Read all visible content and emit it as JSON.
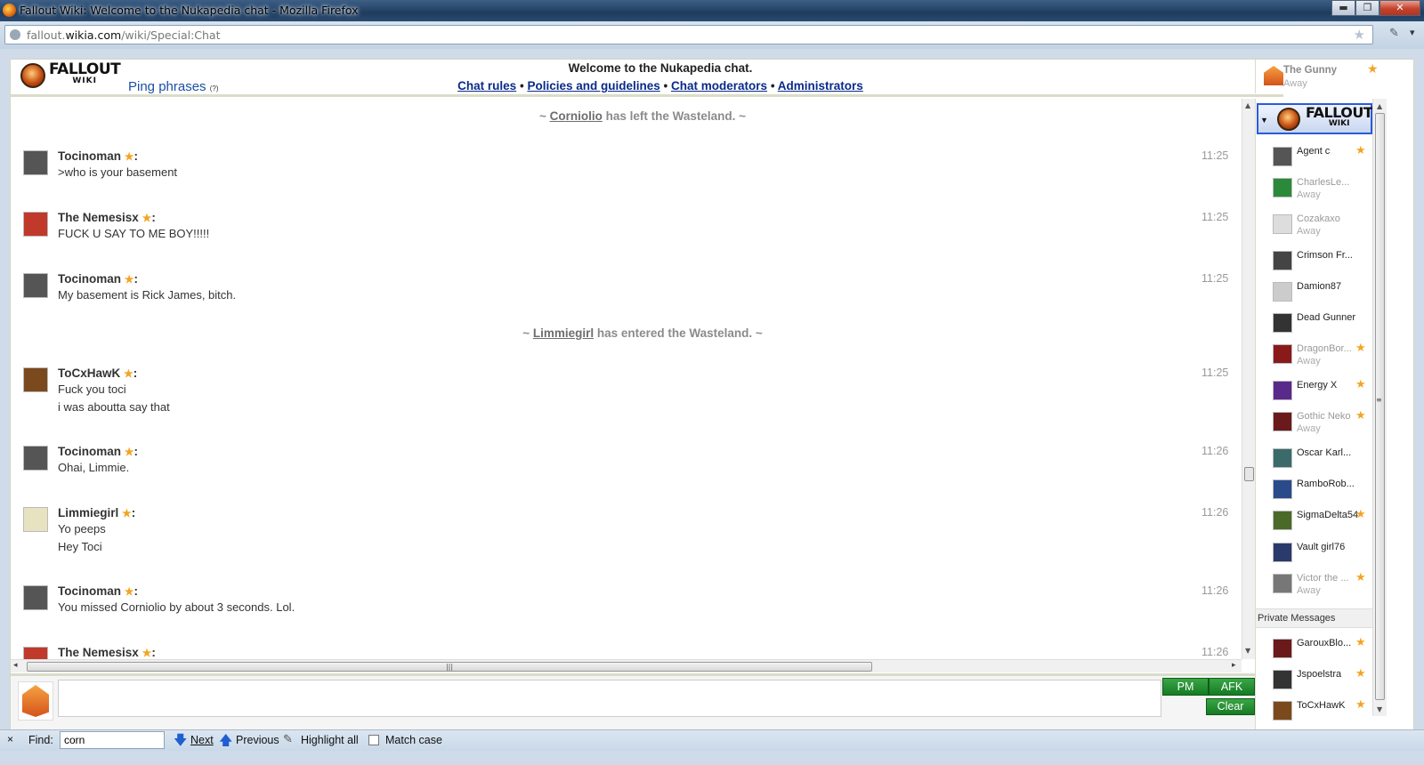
{
  "window": {
    "title": "Fallout Wiki: Welcome to the Nukapedia chat - Mozilla Firefox",
    "min_label": "▬",
    "max_label": "❐",
    "close_label": "✕"
  },
  "address": {
    "url_prefix": "fallout.",
    "url_domain": "wikia.com",
    "url_path": "/wiki/Special:Chat"
  },
  "header": {
    "logo_word1": "FALLOUT",
    "logo_word2": "WIKI",
    "ping_label": "Ping phrases",
    "ping_help": "(?)",
    "welcome": "Welcome to the Nukapedia chat.",
    "links": [
      "Chat rules",
      "Policies and guidelines",
      "Chat moderators",
      "Administrators"
    ],
    "separator": "•"
  },
  "self_user": {
    "name": "The Gunny",
    "status": "Away"
  },
  "chat": {
    "alerts": [
      {
        "prefix": "~ ",
        "user": "Corniolio",
        "text": " has left the Wasteland. ~"
      },
      {
        "prefix": "~ ",
        "user": "Limmiegirl",
        "text": " has entered the Wasteland. ~"
      }
    ],
    "messages": [
      {
        "user": "Tocinoman",
        "time": "11:25",
        "lines": [
          ">who is your basement"
        ]
      },
      {
        "user": "The Nemesisx",
        "time": "11:25",
        "lines": [
          "FUCK U SAY TO ME BOY!!!!!"
        ]
      },
      {
        "user": "Tocinoman",
        "time": "11:25",
        "lines": [
          "My basement is Rick James, bitch."
        ]
      },
      {
        "user": "ToCxHawK",
        "time": "11:25",
        "lines": [
          "Fuck you toci",
          "i was aboutta say that"
        ]
      },
      {
        "user": "Tocinoman",
        "time": "11:26",
        "lines": [
          "Ohai, Limmie."
        ]
      },
      {
        "user": "Limmiegirl",
        "time": "11:26",
        "lines": [
          "Yo peeps",
          "Hey Toci"
        ]
      },
      {
        "user": "Tocinoman",
        "time": "11:26",
        "lines": [
          "You missed Corniolio by about 3 seconds. Lol."
        ]
      },
      {
        "user": "The Nemesisx",
        "time": "11:26",
        "lines": []
      }
    ],
    "name_suffix": ":",
    "star": "★"
  },
  "input": {
    "value": "",
    "pm_label": "PM",
    "afk_label": "AFK",
    "clear_label": "Clear"
  },
  "userlist": {
    "users": [
      {
        "name": "Agent c",
        "status": "",
        "star": true
      },
      {
        "name": "CharlesLe...",
        "status": "Away",
        "star": false
      },
      {
        "name": "Cozakaxo",
        "status": "Away",
        "star": false
      },
      {
        "name": "Crimson Fr...",
        "status": "",
        "star": false
      },
      {
        "name": "Damion87",
        "status": "",
        "star": false
      },
      {
        "name": "Dead Gunner",
        "status": "",
        "star": false
      },
      {
        "name": "DragonBor...",
        "status": "Away",
        "star": true
      },
      {
        "name": "Energy X",
        "status": "",
        "star": true
      },
      {
        "name": "Gothic Neko",
        "status": "Away",
        "star": true
      },
      {
        "name": "Oscar Karl...",
        "status": "",
        "star": false
      },
      {
        "name": "RamboRob...",
        "status": "",
        "star": false
      },
      {
        "name": "SigmaDelta54",
        "status": "",
        "star": true
      },
      {
        "name": "Vault girl76",
        "status": "",
        "star": false
      },
      {
        "name": "Victor the ...",
        "status": "Away",
        "star": true
      }
    ],
    "pm_header": "Private Messages",
    "private": [
      {
        "name": "GarouxBlo...",
        "star": true
      },
      {
        "name": "Jspoelstra",
        "star": true
      },
      {
        "name": "ToCxHawK",
        "star": true
      }
    ]
  },
  "findbar": {
    "close": "×",
    "label": "Find:",
    "value": "corn",
    "next": "Next",
    "previous": "Previous",
    "highlight": "Highlight all",
    "match_case": "Match case"
  },
  "colors": {
    "link": "#0a2a8a",
    "star": "#f2a422",
    "green_button": "#1f8a2e",
    "self_highlight": "#2a5bd8"
  },
  "avatar_colors": {
    "Tocinoman": "#555555",
    "The Nemesisx": "#c0392b",
    "ToCxHawK": "#7a4a1d",
    "Limmiegirl": "#e7e2c0"
  },
  "user_avatar_colors": [
    "#555",
    "#2a8a3a",
    "#ddd",
    "#444",
    "#ccc",
    "#333",
    "#8a1a1a",
    "#5a2a8a",
    "#6a1a1a",
    "#3a6a6a",
    "#2a4a8a",
    "#4a6a2a",
    "#2a3a6a",
    "#777"
  ],
  "pm_avatar_colors": [
    "#6a1a1a",
    "#333",
    "#7a4a1d"
  ]
}
